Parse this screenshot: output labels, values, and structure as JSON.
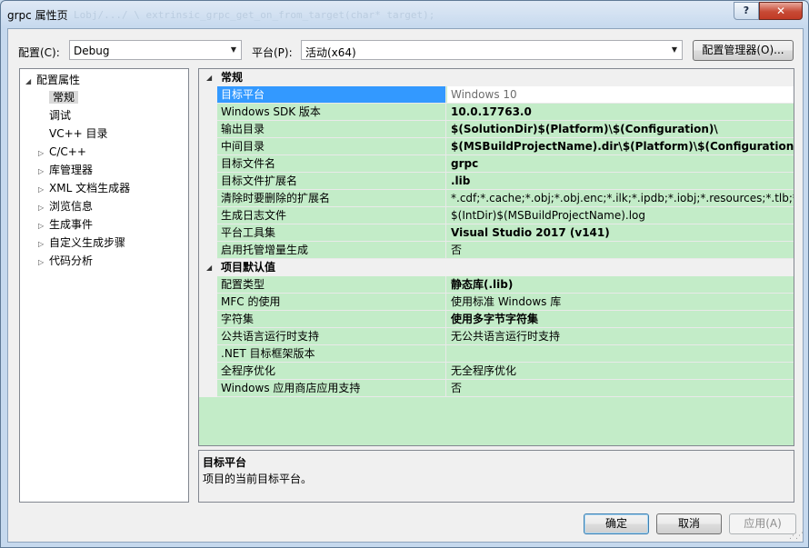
{
  "window": {
    "title": "grpc 属性页",
    "help_label": "?",
    "close_label": "✕",
    "ghost_code": "Lobj/.../ \\ extrinsic_grpc_get_on_from_target(char* target);"
  },
  "toolbar": {
    "config_label": "配置(C):",
    "config_value": "Debug",
    "platform_label": "平台(P):",
    "platform_value": "活动(x64)",
    "config_manager_label": "配置管理器(O)..."
  },
  "tree": {
    "root": "配置属性",
    "items": [
      {
        "label": "常规",
        "expandable": false,
        "selected": true
      },
      {
        "label": "调试",
        "expandable": false
      },
      {
        "label": "VC++ 目录",
        "expandable": false
      },
      {
        "label": "C/C++",
        "expandable": true
      },
      {
        "label": "库管理器",
        "expandable": true
      },
      {
        "label": "XML 文档生成器",
        "expandable": true
      },
      {
        "label": "浏览信息",
        "expandable": true
      },
      {
        "label": "生成事件",
        "expandable": true
      },
      {
        "label": "自定义生成步骤",
        "expandable": true
      },
      {
        "label": "代码分析",
        "expandable": true
      }
    ]
  },
  "grid": {
    "categories": [
      {
        "name": "常规",
        "rows": [
          {
            "name": "目标平台",
            "value": "Windows 10",
            "selected": true
          },
          {
            "name": "Windows SDK 版本",
            "value": "10.0.17763.0",
            "bold": true
          },
          {
            "name": "输出目录",
            "value": "$(SolutionDir)$(Platform)\\$(Configuration)\\",
            "bold": true
          },
          {
            "name": "中间目录",
            "value": "$(MSBuildProjectName).dir\\$(Platform)\\$(Configuration)\\",
            "bold": true
          },
          {
            "name": "目标文件名",
            "value": "grpc",
            "bold": true
          },
          {
            "name": "目标文件扩展名",
            "value": ".lib",
            "bold": true
          },
          {
            "name": "清除时要删除的扩展名",
            "value": "*.cdf;*.cache;*.obj;*.obj.enc;*.ilk;*.ipdb;*.iobj;*.resources;*.tlb;*.tli;*.t"
          },
          {
            "name": "生成日志文件",
            "value": "$(IntDir)$(MSBuildProjectName).log"
          },
          {
            "name": "平台工具集",
            "value": "Visual Studio 2017 (v141)",
            "bold": true
          },
          {
            "name": "启用托管增量生成",
            "value": "否"
          }
        ]
      },
      {
        "name": "项目默认值",
        "rows": [
          {
            "name": "配置类型",
            "value": "静态库(.lib)",
            "bold": true
          },
          {
            "name": "MFC 的使用",
            "value": "使用标准 Windows 库"
          },
          {
            "name": "字符集",
            "value": "使用多字节字符集",
            "bold": true
          },
          {
            "name": "公共语言运行时支持",
            "value": "无公共语言运行时支持"
          },
          {
            "name": ".NET 目标框架版本",
            "value": ""
          },
          {
            "name": "全程序优化",
            "value": "无全程序优化"
          },
          {
            "name": "Windows 应用商店应用支持",
            "value": "否"
          }
        ]
      }
    ]
  },
  "description": {
    "title": "目标平台",
    "text": "项目的当前目标平台。"
  },
  "buttons": {
    "ok": "确定",
    "cancel": "取消",
    "apply": "应用(A)"
  },
  "colors": {
    "grid_bg": "#c3ecc8",
    "selection": "#3399ff",
    "close_red": "#c74a35"
  }
}
